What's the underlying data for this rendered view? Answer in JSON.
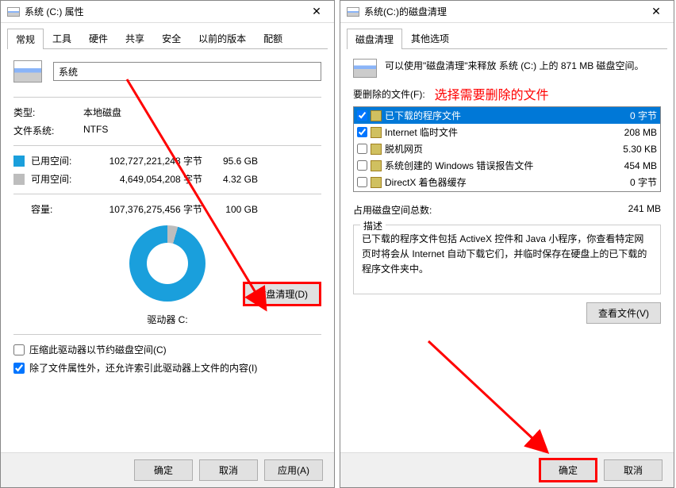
{
  "left": {
    "title": "系统 (C:) 属性",
    "tabs": [
      "常规",
      "工具",
      "硬件",
      "共享",
      "安全",
      "以前的版本",
      "配额"
    ],
    "active_tab": 0,
    "drive_name": "系统",
    "type_label": "类型:",
    "type_value": "本地磁盘",
    "fs_label": "文件系统:",
    "fs_value": "NTFS",
    "used_label": "已用空间:",
    "used_bytes": "102,727,221,248 字节",
    "used_size": "95.6 GB",
    "free_label": "可用空间:",
    "free_bytes": "4,649,054,208 字节",
    "free_size": "4.32 GB",
    "capacity_label": "容量:",
    "capacity_bytes": "107,376,275,456 字节",
    "capacity_size": "100 GB",
    "donut_label": "驱动器 C:",
    "cleanup_btn": "磁盘清理(D)",
    "compress_check": "压缩此驱动器以节约磁盘空间(C)",
    "index_check": "除了文件属性外，还允许索引此驱动器上文件的内容(I)",
    "ok_btn": "确定",
    "cancel_btn": "取消",
    "apply_btn": "应用(A)"
  },
  "right": {
    "title": "系统(C:)的磁盘清理",
    "tabs": [
      "磁盘清理",
      "其他选项"
    ],
    "active_tab": 0,
    "intro": "可以使用\"磁盘清理\"来释放 系统 (C:) 上的 871 MB 磁盘空间。",
    "files_label": "要删除的文件(F):",
    "annotation": "选择需要删除的文件",
    "items": [
      {
        "checked": true,
        "name": "已下载的程序文件",
        "size": "0 字节",
        "selected": true
      },
      {
        "checked": true,
        "name": "Internet 临时文件",
        "size": "208 MB",
        "selected": false
      },
      {
        "checked": false,
        "name": "脱机网页",
        "size": "5.30 KB",
        "selected": false
      },
      {
        "checked": false,
        "name": "系统创建的 Windows 错误报告文件",
        "size": "454 MB",
        "selected": false
      },
      {
        "checked": false,
        "name": "DirectX 着色器缓存",
        "size": "0 字节",
        "selected": false
      }
    ],
    "total_label": "占用磁盘空间总数:",
    "total_value": "241 MB",
    "desc_title": "描述",
    "desc_text": "已下载的程序文件包括 ActiveX 控件和 Java 小程序，你查看特定网页时将会从 Internet 自动下载它们，并临时保存在硬盘上的已下载的程序文件夹中。",
    "view_btn": "查看文件(V)",
    "ok_btn": "确定",
    "cancel_btn": "取消"
  }
}
